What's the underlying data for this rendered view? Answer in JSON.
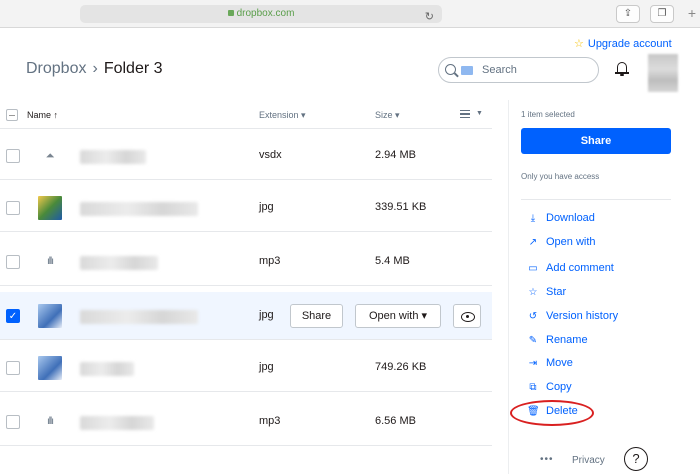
{
  "browser": {
    "url": "dropbox.com",
    "reload_icon": "reload-icon",
    "share_icon": "share-icon",
    "tabs_icon": "tabs-icon",
    "plus": "+"
  },
  "header": {
    "upgrade": "Upgrade account",
    "breadcrumb_root": "Dropbox",
    "breadcrumb_sep": "›",
    "breadcrumb_current": "Folder 3",
    "search_placeholder": "Search"
  },
  "table": {
    "headers": {
      "name": "Name ↑",
      "extension": "Extension ▾",
      "size": "Size ▾"
    },
    "rows": [
      {
        "extension": "vsdx",
        "size": "2.94 MB",
        "thumb": "file-icon",
        "selected": false
      },
      {
        "extension": "jpg",
        "size": "339.51 KB",
        "thumb": "image-thumb",
        "selected": false
      },
      {
        "extension": "mp3",
        "size": "5.4 MB",
        "thumb": "audio-icon",
        "selected": false
      },
      {
        "extension": "jpg",
        "size": "",
        "thumb": "image-thumb",
        "selected": true
      },
      {
        "extension": "jpg",
        "size": "749.26 KB",
        "thumb": "image-thumb",
        "selected": false
      },
      {
        "extension": "mp3",
        "size": "6.56 MB",
        "thumb": "audio-icon",
        "selected": false
      }
    ],
    "row_actions": {
      "share": "Share",
      "open_with": "Open with ▾"
    }
  },
  "sidebar": {
    "selected_count": "1 item selected",
    "share": "Share",
    "access": "Only you have access",
    "actions": [
      {
        "label": "Download",
        "icon": "download-icon"
      },
      {
        "label": "Open with",
        "icon": "open-with-icon"
      },
      {
        "label": "Add comment",
        "icon": "comment-icon"
      },
      {
        "label": "Star",
        "icon": "star-icon"
      },
      {
        "label": "Version history",
        "icon": "history-icon"
      },
      {
        "label": "Rename",
        "icon": "rename-icon"
      },
      {
        "label": "Move",
        "icon": "move-icon"
      },
      {
        "label": "Copy",
        "icon": "copy-icon"
      },
      {
        "label": "Delete",
        "icon": "trash-icon"
      }
    ],
    "more": "•••",
    "privacy": "Privacy",
    "help": "?"
  },
  "colors": {
    "accent": "#0061fe",
    "highlight_ring": "#d92020",
    "selected_row": "#f0f6ff"
  }
}
